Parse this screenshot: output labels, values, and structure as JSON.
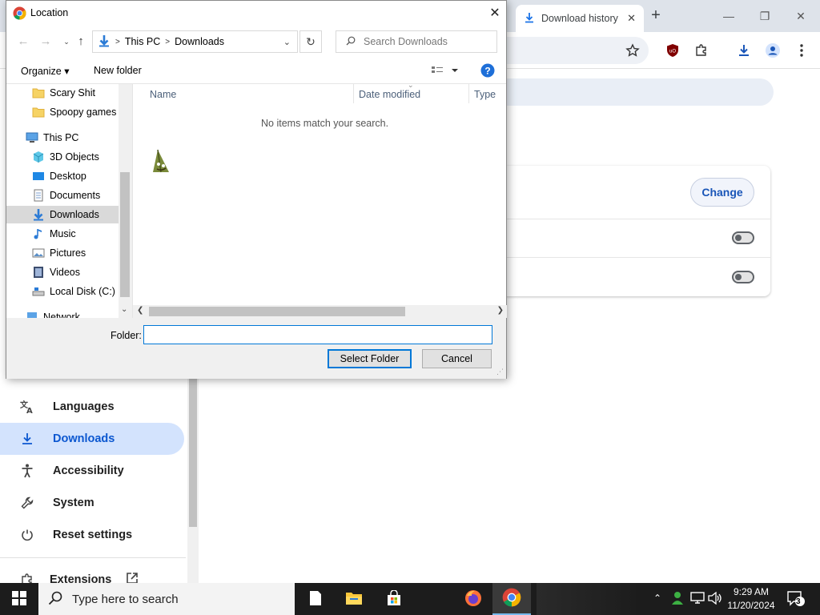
{
  "chrome": {
    "tab_title": "Download history",
    "tab_close": "✕",
    "newtab": "+",
    "win_min": "—",
    "win_restore": "❐",
    "win_close": "✕",
    "settings_change_label": "Change",
    "sidebar": [
      {
        "label": "Languages",
        "icon": "languages-icon"
      },
      {
        "label": "Downloads",
        "icon": "download-icon"
      },
      {
        "label": "Accessibility",
        "icon": "accessibility-icon"
      },
      {
        "label": "System",
        "icon": "wrench-icon"
      },
      {
        "label": "Reset settings",
        "icon": "reset-icon"
      },
      {
        "label": "Extensions",
        "icon": "puzzle-icon"
      }
    ]
  },
  "dialog": {
    "title": "Location",
    "close": "✕",
    "address": {
      "part1": "This PC",
      "part2": "Downloads",
      "sep": ">"
    },
    "search_placeholder": "Search Downloads",
    "organize_label": "Organize ▾",
    "new_folder_label": "New folder",
    "nav_items": [
      {
        "label": "Scary Shit",
        "icon": "folder-icon"
      },
      {
        "label": "Spoopy games",
        "icon": "folder-icon"
      },
      {
        "label": "This PC",
        "icon": "pc-icon"
      },
      {
        "label": "3D Objects",
        "icon": "3d-objects-icon"
      },
      {
        "label": "Desktop",
        "icon": "desktop-icon"
      },
      {
        "label": "Documents",
        "icon": "documents-icon"
      },
      {
        "label": "Downloads",
        "icon": "download-icon"
      },
      {
        "label": "Music",
        "icon": "music-icon"
      },
      {
        "label": "Pictures",
        "icon": "pictures-icon"
      },
      {
        "label": "Videos",
        "icon": "videos-icon"
      },
      {
        "label": "Local Disk (C:)",
        "icon": "drive-icon"
      },
      {
        "label": "Network",
        "icon": "network-icon"
      }
    ],
    "columns": [
      "Name",
      "Date modified",
      "Type"
    ],
    "empty_message": "No items match your search.",
    "folder_label": "Folder:",
    "folder_value": "",
    "select_button": "Select Folder",
    "cancel_button": "Cancel"
  },
  "taskbar": {
    "search_text": "Type here to search",
    "time": "9:29 AM",
    "date": "11/20/2024",
    "notification_count": "3"
  },
  "colors": {
    "accent": "#0078d7",
    "chrome_blue": "#0b57d0",
    "taskbar": "#1c1c1c"
  }
}
